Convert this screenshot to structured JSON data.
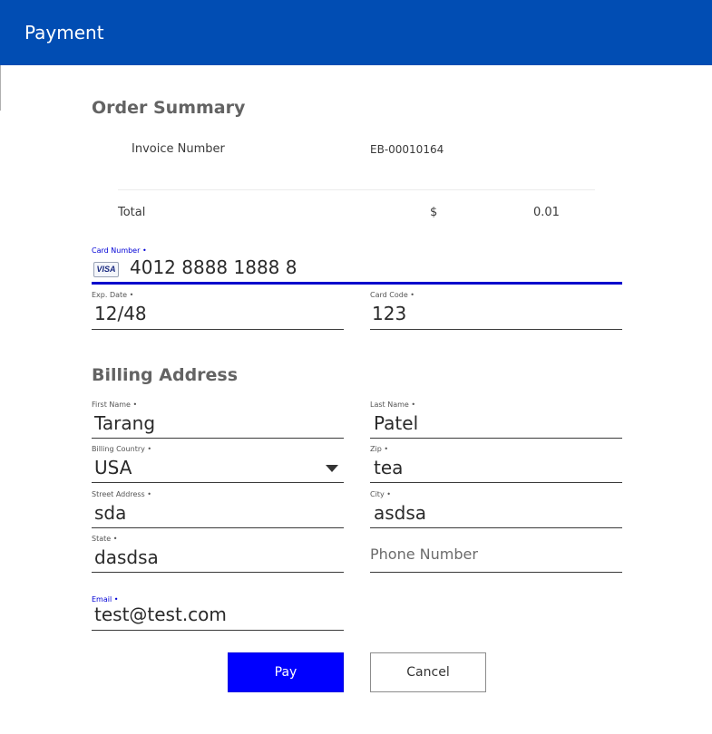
{
  "header": {
    "title": "Payment"
  },
  "order_summary": {
    "title": "Order Summary",
    "invoice_label": "Invoice Number",
    "invoice_value": "EB-00010164",
    "total_label": "Total",
    "currency": "$",
    "total_value": "0.01"
  },
  "card": {
    "number_label": "Card Number •",
    "number_value": "4012 8888 1888 8",
    "brand": "VISA",
    "exp_label": "Exp. Date •",
    "exp_value": "12/48",
    "code_label": "Card Code •",
    "code_value": "123"
  },
  "billing": {
    "title": "Billing Address",
    "first_name_label": "First Name •",
    "first_name_value": "Tarang",
    "last_name_label": "Last Name •",
    "last_name_value": "Patel",
    "country_label": "Billing Country •",
    "country_value": "USA",
    "zip_label": "Zip •",
    "zip_value": "tea",
    "street_label": "Street Address •",
    "street_value": "sda",
    "city_label": "City •",
    "city_value": "asdsa",
    "state_label": "State •",
    "state_value": "dasdsa",
    "phone_placeholder": "Phone Number",
    "email_label": "Email •",
    "email_value": "test@test.com"
  },
  "actions": {
    "pay_label": "Pay",
    "cancel_label": "Cancel"
  },
  "colors": {
    "header": "#014db3",
    "accent": "#0000ff",
    "active_field": "#0000cc"
  }
}
